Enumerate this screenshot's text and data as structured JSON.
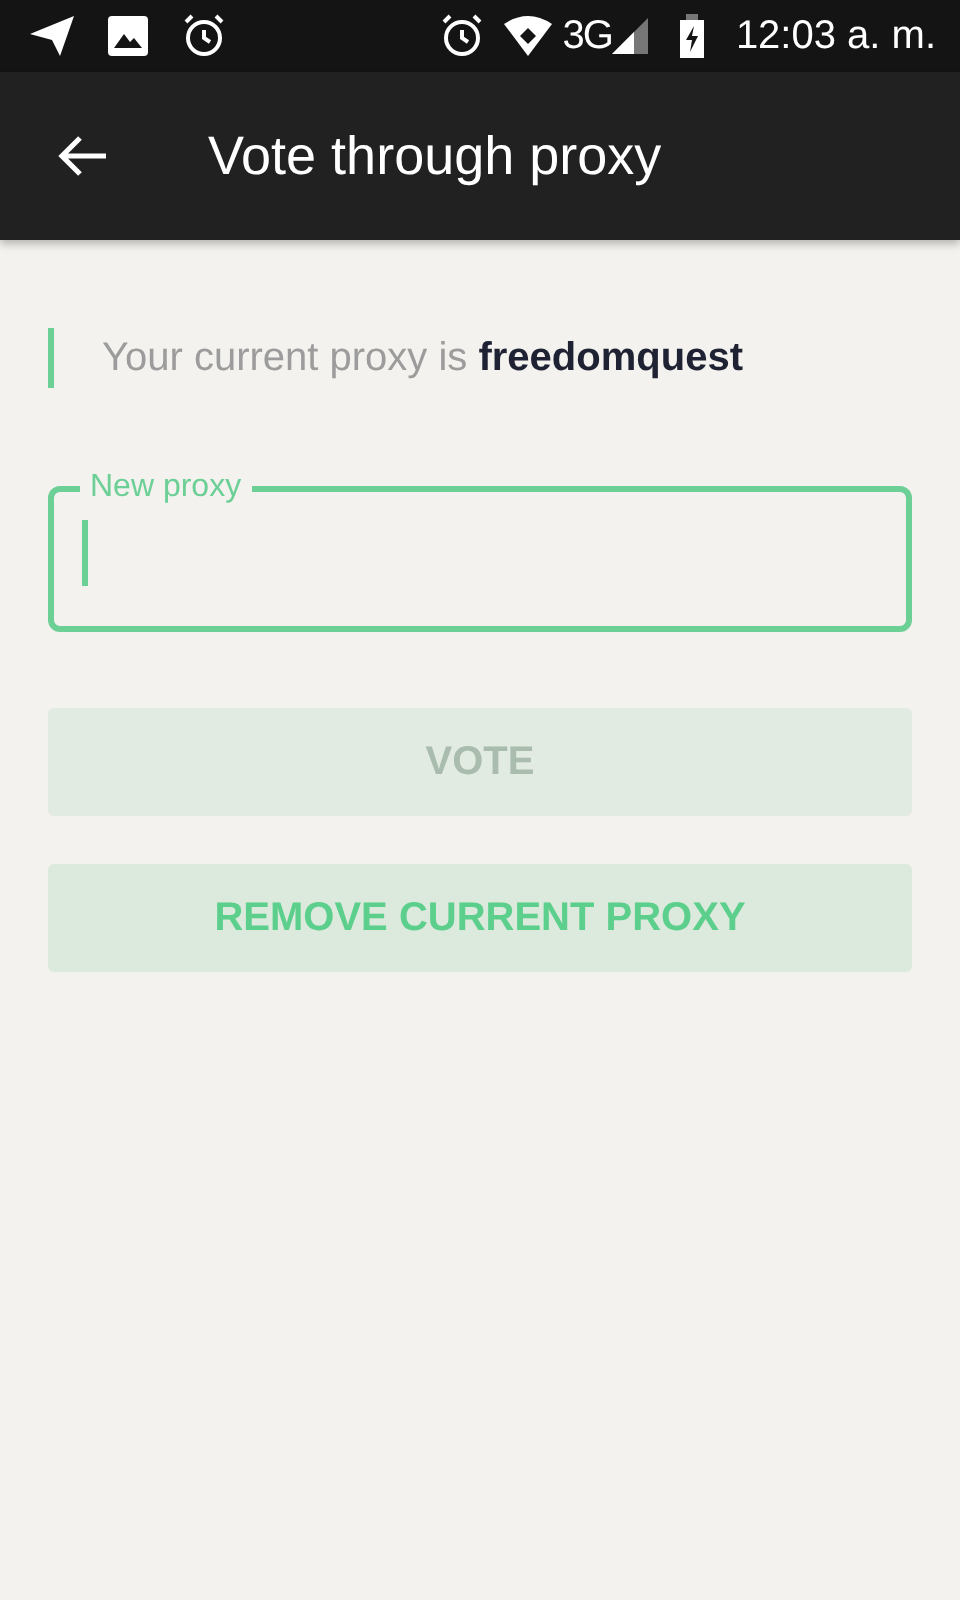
{
  "status_bar": {
    "time": "12:03 a. m.",
    "network": "3G"
  },
  "app_bar": {
    "title": "Vote through proxy"
  },
  "current_proxy": {
    "text": "Your current proxy is **freedomquest**"
  },
  "field": {
    "label": "New proxy",
    "focused": true
  },
  "buttons": [
    {
      "label": "VOTE",
      "disabled": true
    },
    {
      "label": "REMOVE CURRENT PROXY",
      "disabled": false
    }
  ]
}
